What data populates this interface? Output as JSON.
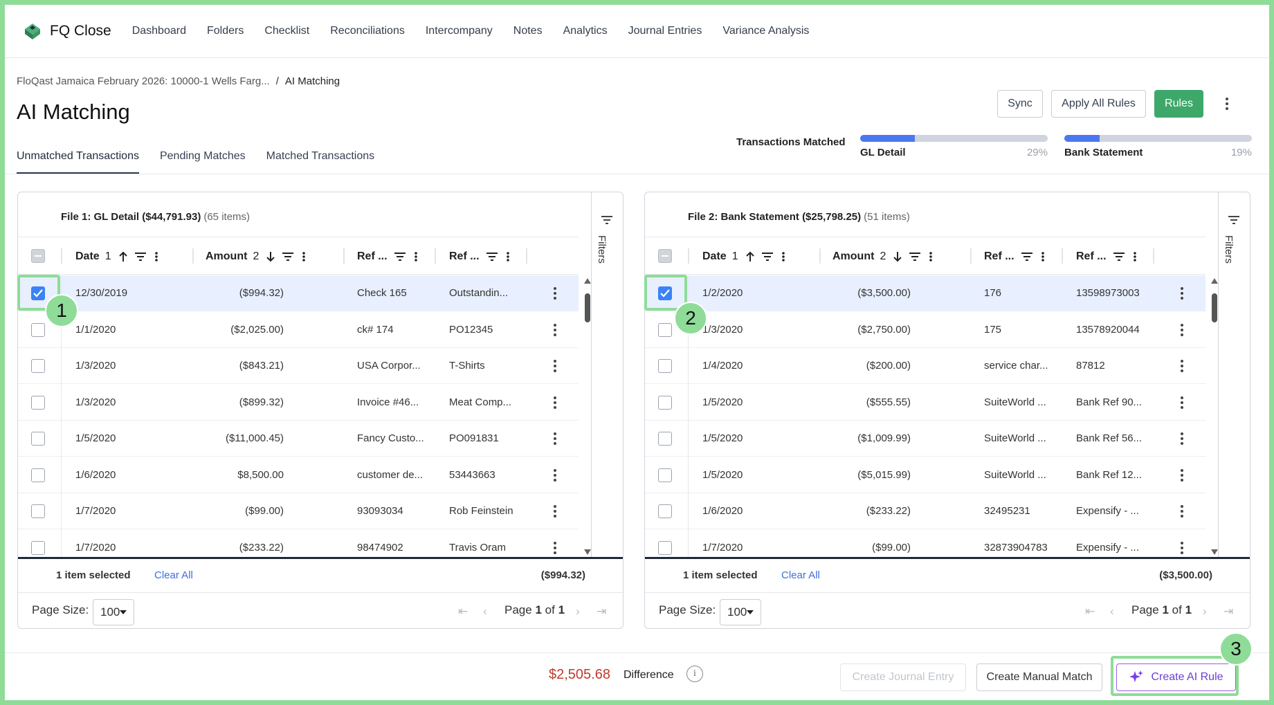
{
  "nav": {
    "brand": "FQ Close",
    "links": [
      "Dashboard",
      "Folders",
      "Checklist",
      "Reconciliations",
      "Intercompany",
      "Notes",
      "Analytics",
      "Journal Entries",
      "Variance Analysis"
    ]
  },
  "breadcrumb": {
    "parent": "FloQast Jamaica February 2026: 10000-1 Wells Farg...",
    "separator": "/",
    "current": "AI Matching"
  },
  "page_title": "AI Matching",
  "toolbar": {
    "sync": "Sync",
    "apply_all": "Apply All Rules",
    "rules": "Rules",
    "more_icon": "more-vertical-icon"
  },
  "tabs": [
    {
      "label": "Unmatched Transactions",
      "active": true
    },
    {
      "label": "Pending Matches",
      "active": false
    },
    {
      "label": "Matched Transactions",
      "active": false
    }
  ],
  "progress": {
    "label": "Transactions Matched",
    "gl": {
      "label": "GL Detail",
      "pct_text": "29%",
      "value": 0.29
    },
    "bank": {
      "label": "Bank Statement",
      "pct_text": "19%",
      "value": 0.19
    },
    "fill_color": "#4a78ef",
    "track_color": "#cfd4df"
  },
  "file1": {
    "name": "File 1: GL Detail",
    "total": "($44,791.93)",
    "count": "(65 items)",
    "filters_label": "Filters",
    "columns": {
      "date": "Date",
      "date_n": "1",
      "amount": "Amount",
      "amount_n": "2",
      "ref1": "Ref ...",
      "ref2": "Ref ..."
    },
    "rows": [
      {
        "date": "12/30/2019",
        "amount": "($994.32)",
        "ref1": "Check 165",
        "ref2": "Outstandin...",
        "checked": true
      },
      {
        "date": "1/1/2020",
        "amount": "($2,025.00)",
        "ref1": "ck# 174",
        "ref2": "PO12345",
        "checked": false
      },
      {
        "date": "1/3/2020",
        "amount": "($843.21)",
        "ref1": "USA Corpor...",
        "ref2": "T-Shirts",
        "checked": false
      },
      {
        "date": "1/3/2020",
        "amount": "($899.32)",
        "ref1": "Invoice #46...",
        "ref2": "Meat Comp...",
        "checked": false
      },
      {
        "date": "1/5/2020",
        "amount": "($11,000.45)",
        "ref1": "Fancy Custo...",
        "ref2": "PO091831",
        "checked": false
      },
      {
        "date": "1/6/2020",
        "amount": "$8,500.00",
        "ref1": "customer de...",
        "ref2": "53443663",
        "checked": false
      },
      {
        "date": "1/7/2020",
        "amount": "($99.00)",
        "ref1": "93093034",
        "ref2": "Rob Feinstein",
        "checked": false
      },
      {
        "date": "1/7/2020",
        "amount": "($233.22)",
        "ref1": "98474902",
        "ref2": "Travis Oram",
        "checked": false
      }
    ],
    "selected_text": "1 item selected",
    "clear_all": "Clear All",
    "selected_total": "($994.32)",
    "page_size_label": "Page Size:",
    "page_size": "100",
    "page_word": "Page",
    "page_current": "1",
    "page_of": "of",
    "page_total": "1"
  },
  "file2": {
    "name": "File 2: Bank Statement",
    "total": "($25,798.25)",
    "count": "(51 items)",
    "filters_label": "Filters",
    "columns": {
      "date": "Date",
      "date_n": "1",
      "amount": "Amount",
      "amount_n": "2",
      "ref1": "Ref ...",
      "ref2": "Ref ..."
    },
    "rows": [
      {
        "date": "1/2/2020",
        "amount": "($3,500.00)",
        "ref1": "176",
        "ref2": "13598973003",
        "checked": true
      },
      {
        "date": "1/3/2020",
        "amount": "($2,750.00)",
        "ref1": "175",
        "ref2": "13578920044",
        "checked": false
      },
      {
        "date": "1/4/2020",
        "amount": "($200.00)",
        "ref1": "service char...",
        "ref2": "87812",
        "checked": false
      },
      {
        "date": "1/5/2020",
        "amount": "($555.55)",
        "ref1": "SuiteWorld ...",
        "ref2": "Bank Ref 90...",
        "checked": false
      },
      {
        "date": "1/5/2020",
        "amount": "($1,009.99)",
        "ref1": "SuiteWorld ...",
        "ref2": "Bank Ref 56...",
        "checked": false
      },
      {
        "date": "1/5/2020",
        "amount": "($5,015.99)",
        "ref1": "SuiteWorld ...",
        "ref2": "Bank Ref 12...",
        "checked": false
      },
      {
        "date": "1/6/2020",
        "amount": "($233.22)",
        "ref1": "32495231",
        "ref2": "Expensify - ...",
        "checked": false
      },
      {
        "date": "1/7/2020",
        "amount": "($99.00)",
        "ref1": "32873904783",
        "ref2": "Expensify - ...",
        "checked": false
      }
    ],
    "selected_text": "1 item selected",
    "clear_all": "Clear All",
    "selected_total": "($3,500.00)",
    "page_size_label": "Page Size:",
    "page_size": "100",
    "page_word": "Page",
    "page_current": "1",
    "page_of": "of",
    "page_total": "1"
  },
  "bottom": {
    "difference_value": "$2,505.68",
    "difference_label": "Difference",
    "info_icon": "info-icon",
    "create_je": "Create Journal Entry",
    "create_manual": "Create Manual Match",
    "create_ai": "Create AI Rule"
  },
  "annotations": {
    "step1": "1",
    "step2": "2",
    "step3": "3",
    "color": "#8edc98"
  },
  "colors": {
    "accent_green": "#3ea86b",
    "link_blue": "#3b6fe0",
    "difference_red": "#c0392b",
    "ai_purple": "#6c3dd6",
    "selected_row": "#e8efff"
  }
}
